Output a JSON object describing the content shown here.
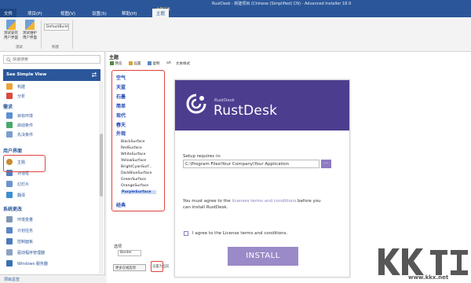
{
  "window": {
    "title": "RustDesk - 新建项目 (Chinese (Simplified) CN) - Advanced Installer 18.9"
  },
  "tabs": [
    {
      "label": "文件"
    },
    {
      "label": "项目(P)"
    },
    {
      "label": "视图(V)"
    },
    {
      "label": "设置(S)"
    },
    {
      "label": "帮助(H)"
    },
    {
      "label": "主题工具"
    },
    {
      "label": "主题"
    }
  ],
  "ribbon": {
    "btn1": "测试安装用户界面",
    "btn2": "测试维护用户界面",
    "build_dropdown": "DefaultBuild",
    "group_test": "测试",
    "group_build": "构建"
  },
  "sidebar": {
    "search_placeholder": "快速搜索",
    "simple_view": "See Simple View",
    "items_top": [
      "构建",
      "分析"
    ],
    "head_requirements": "需求",
    "items_req": [
      "目标环境",
      "启动条件",
      "先决条件"
    ],
    "head_ui": "用户界面",
    "items_ui": [
      "主题",
      "对话框",
      "幻灯片",
      "翻译"
    ],
    "head_system": "系统更改",
    "items_sys": [
      "环境变量",
      "计划任务",
      "控制面板",
      "驱动程序管理器",
      "Windows 服务器"
    ],
    "bottom": "项目总览"
  },
  "section_title": "主题",
  "toolbar2": {
    "btn_preview": "预览",
    "btn_apply": "设置",
    "btn_copy": "复制",
    "btn_text": "文本样式",
    "aa": "aA"
  },
  "themes": {
    "categories": [
      "空气",
      "天蓝",
      "石墨",
      "简单",
      "现代",
      "春天",
      "外观",
      "经典"
    ],
    "surfaces": [
      "BlackSurface",
      "RedSurface",
      "WhiteSurface",
      "YellowSurface",
      "BrightCyanSurf...",
      "DarkBlueSurface",
      "GreenSurface",
      "OrangeSurface",
      "PurpleSurface"
    ]
  },
  "options": {
    "label": "选项",
    "border": "Border",
    "btn_a": "更多在线选项",
    "btn_b": "设置为当前"
  },
  "preview": {
    "subtitle": "RustDesk",
    "app_name": "RustDesk",
    "setup_label": "Setup requires in:",
    "install_path": "C:\\Program Files\\Your Company\\Your Application",
    "browse": "...",
    "agree_line1a": "You must agree to the ",
    "agree_link": "licenses terms and conditions",
    "agree_line1b": " before you",
    "agree_line2": "can install RustDesk.",
    "checkbox_label": "I agree to the License terms and conditions.",
    "install": "INSTALL"
  },
  "watermark": {
    "url": "www.kkx.net"
  },
  "colors": {
    "accent": "#2b579a",
    "highlight": "#e0443b",
    "purple": "#4d3d8f",
    "purple_light": "#9b8ac8"
  }
}
